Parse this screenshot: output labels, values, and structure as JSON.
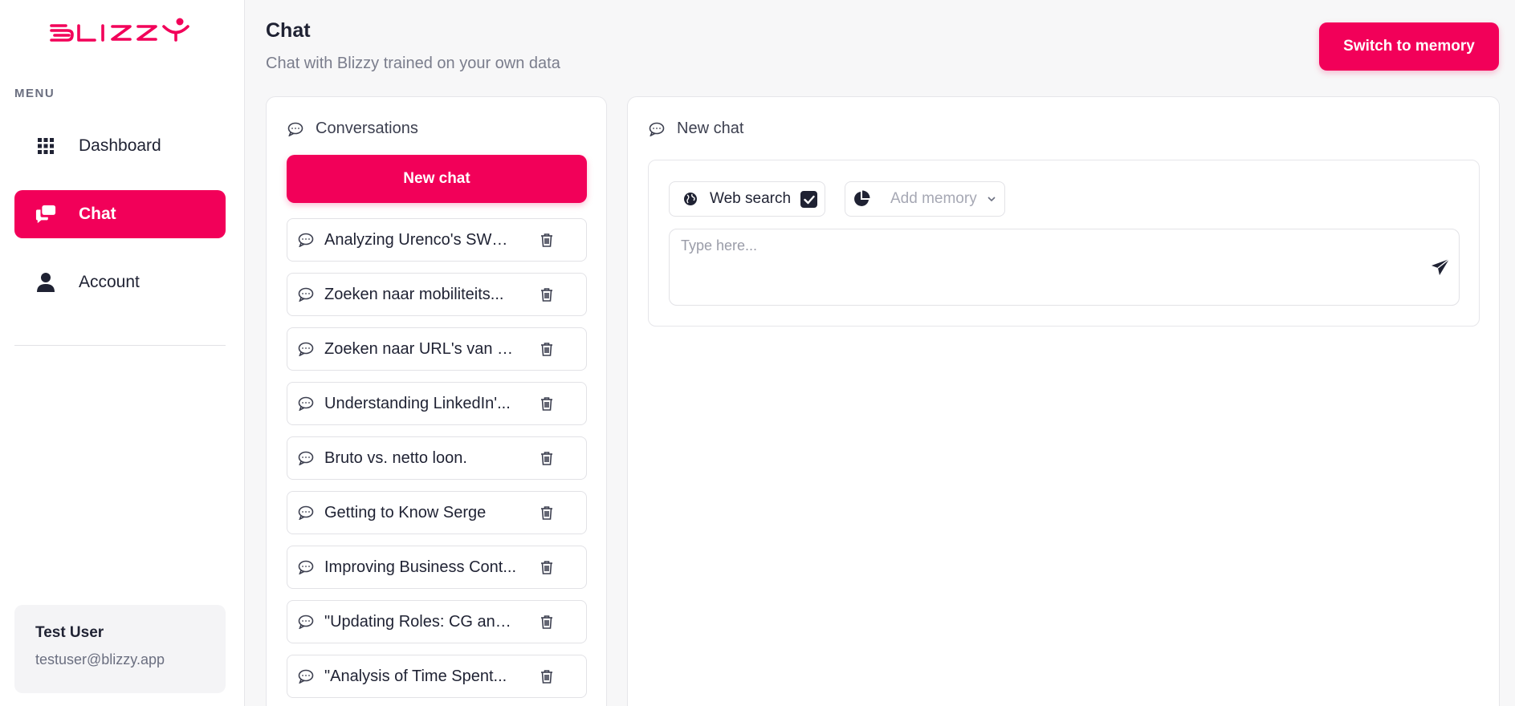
{
  "brand": {
    "name": "BLIZZY",
    "accent_color": "#f20059"
  },
  "sidebar": {
    "menu_label": "MENU",
    "items": [
      {
        "label": "Dashboard",
        "icon": "grid-icon",
        "active": false
      },
      {
        "label": "Chat",
        "icon": "chat-bubbles-icon",
        "active": true
      },
      {
        "label": "Account",
        "icon": "user-icon",
        "active": false
      }
    ],
    "user": {
      "name": "Test User",
      "email": "testuser@blizzy.app"
    }
  },
  "header": {
    "title": "Chat",
    "subtitle": "Chat with Blizzy trained on your own data",
    "switch_button": "Switch to memory"
  },
  "conversations": {
    "heading": "Conversations",
    "new_chat_button": "New chat",
    "items": [
      {
        "title": "Analyzing Urenco's SWOT..."
      },
      {
        "title": "Zoeken naar mobiliteits..."
      },
      {
        "title": "Zoeken naar URL's van p..."
      },
      {
        "title": "Understanding LinkedIn'..."
      },
      {
        "title": "Bruto vs. netto loon."
      },
      {
        "title": "Getting to Know Serge"
      },
      {
        "title": "Improving Business Cont..."
      },
      {
        "title": "\"Updating Roles: CG and..."
      },
      {
        "title": "\"Analysis of Time Spent..."
      }
    ]
  },
  "chat": {
    "heading": "New chat",
    "web_search": {
      "label": "Web search",
      "checked": true
    },
    "memory_select": {
      "placeholder": "Add memory"
    },
    "message_input": {
      "placeholder": "Type here...",
      "value": ""
    }
  }
}
